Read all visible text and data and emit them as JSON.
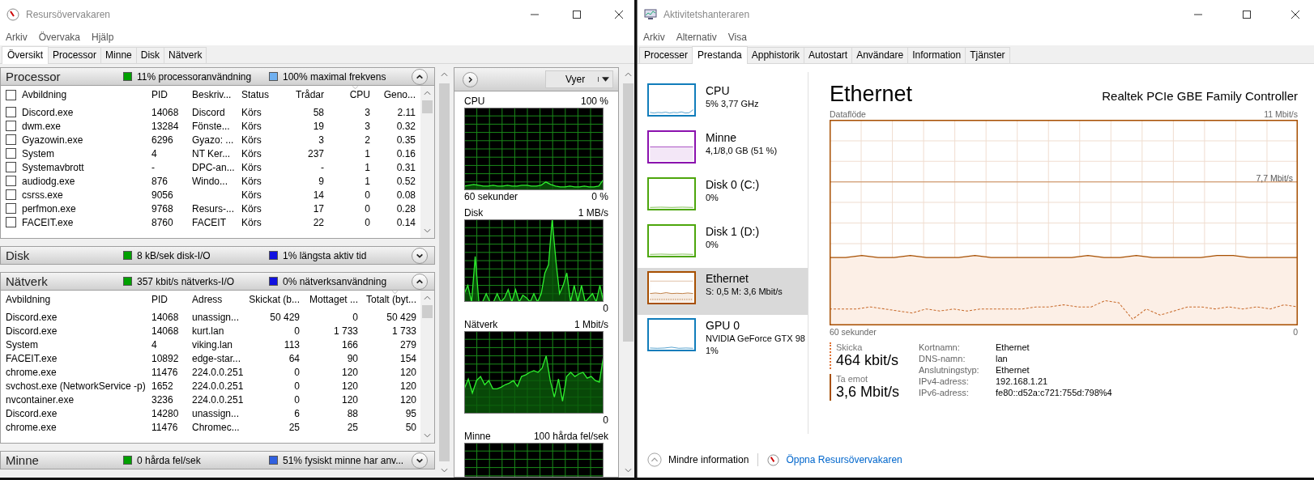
{
  "resource_monitor": {
    "title": "Resursövervakaren",
    "menu": [
      "Arkiv",
      "Övervaka",
      "Hjälp"
    ],
    "tabs": [
      {
        "label": "Översikt",
        "selected": true
      },
      {
        "label": "Processor",
        "selected": false
      },
      {
        "label": "Minne",
        "selected": false
      },
      {
        "label": "Disk",
        "selected": false
      },
      {
        "label": "Nätverk",
        "selected": false
      }
    ],
    "sections": [
      {
        "title": "Processor",
        "expanded": true,
        "indicators": [
          {
            "text": "11% processoranvändning",
            "color": "#00a000"
          },
          {
            "text": "100% maximal frekvens",
            "color": "#70b0f0"
          }
        ],
        "table": {
          "all_checked": false,
          "columns": [
            {
              "label": "Avbildning",
              "kind": "text",
              "sorted": false
            },
            {
              "label": "PID",
              "kind": "text",
              "sorted": false
            },
            {
              "label": "Beskriv...",
              "kind": "text",
              "sorted": false
            },
            {
              "label": "Status",
              "kind": "text",
              "sorted": false
            },
            {
              "label": "Trådar",
              "kind": "number",
              "sorted": false
            },
            {
              "label": "CPU",
              "kind": "number",
              "sorted": true
            },
            {
              "label": "Geno...",
              "kind": "number",
              "sorted": false
            }
          ],
          "rows": [
            {
              "checked": false,
              "cells": [
                "Discord.exe",
                "14068",
                "Discord",
                "Körs",
                "58",
                "3",
                "2.11"
              ]
            },
            {
              "checked": false,
              "cells": [
                "dwm.exe",
                "13284",
                "Fönste...",
                "Körs",
                "19",
                "3",
                "0.32"
              ]
            },
            {
              "checked": false,
              "cells": [
                "Gyazowin.exe",
                "6296",
                "Gyazo: ...",
                "Körs",
                "3",
                "2",
                "0.35"
              ]
            },
            {
              "checked": false,
              "cells": [
                "System",
                "4",
                "NT Ker...",
                "Körs",
                "237",
                "1",
                "0.16"
              ]
            },
            {
              "checked": false,
              "cells": [
                "Systemavbrott",
                "-",
                "DPC-an...",
                "Körs",
                "-",
                "1",
                "0.31"
              ]
            },
            {
              "checked": false,
              "cells": [
                "audiodg.exe",
                "876",
                "Windo...",
                "Körs",
                "9",
                "1",
                "0.52"
              ]
            },
            {
              "checked": false,
              "cells": [
                "csrss.exe",
                "9056",
                "",
                "Körs",
                "14",
                "0",
                "0.08"
              ]
            },
            {
              "checked": false,
              "cells": [
                "perfmon.exe",
                "9768",
                "Resurs-...",
                "Körs",
                "17",
                "0",
                "0.28"
              ]
            },
            {
              "checked": false,
              "cells": [
                "FACEIT.exe",
                "8760",
                "FACEIT",
                "Körs",
                "22",
                "0",
                "0.14"
              ]
            }
          ]
        }
      },
      {
        "title": "Disk",
        "expanded": false,
        "indicators": [
          {
            "text": "8 kB/sek disk-I/O",
            "color": "#00a000"
          },
          {
            "text": "1% längsta aktiv tid",
            "color": "#1010e0"
          }
        ]
      },
      {
        "title": "Nätverk",
        "expanded": true,
        "indicators": [
          {
            "text": "357 kbit/s nätverks-I/O",
            "color": "#00a000"
          },
          {
            "text": "0% nätverksanvändning",
            "color": "#1010e0"
          }
        ],
        "table": {
          "columns": [
            {
              "label": "Avbildning",
              "kind": "text",
              "sorted": false
            },
            {
              "label": "PID",
              "kind": "text",
              "sorted": false
            },
            {
              "label": "Adress",
              "kind": "text",
              "sorted": false
            },
            {
              "label": "Skickat (b...",
              "kind": "number",
              "sorted": false
            },
            {
              "label": "Mottaget ...",
              "kind": "number",
              "sorted": false
            },
            {
              "label": "Totalt (byt...",
              "kind": "number",
              "sorted": true
            }
          ],
          "rows": [
            {
              "cells": [
                "Discord.exe",
                "14068",
                "unassign...",
                "50 429",
                "0",
                "50 429"
              ]
            },
            {
              "cells": [
                "Discord.exe",
                "14068",
                "kurt.lan",
                "0",
                "1 733",
                "1 733"
              ]
            },
            {
              "cells": [
                "System",
                "4",
                "viking.lan",
                "113",
                "166",
                "279"
              ]
            },
            {
              "cells": [
                "FACEIT.exe",
                "10892",
                "edge-star...",
                "64",
                "90",
                "154"
              ]
            },
            {
              "cells": [
                "chrome.exe",
                "11476",
                "224.0.0.251",
                "0",
                "120",
                "120"
              ]
            },
            {
              "cells": [
                "svchost.exe (NetworkService -p)",
                "1652",
                "224.0.0.251",
                "0",
                "120",
                "120"
              ]
            },
            {
              "cells": [
                "nvcontainer.exe",
                "3236",
                "224.0.0.251",
                "0",
                "120",
                "120"
              ]
            },
            {
              "cells": [
                "Discord.exe",
                "14280",
                "unassign...",
                "6",
                "88",
                "95"
              ]
            },
            {
              "cells": [
                "chrome.exe",
                "11476",
                "Chromec...",
                "25",
                "25",
                "50"
              ]
            }
          ]
        }
      },
      {
        "title": "Minne",
        "expanded": false,
        "indicators": [
          {
            "text": "0 hårda fel/sek",
            "color": "#00a000"
          },
          {
            "text": "51% fysiskt minne har anv...",
            "color": "#3060e0"
          }
        ]
      }
    ],
    "graph_panel": {
      "views_label": "Vyer",
      "graphs": [
        {
          "kind": "cpu",
          "title": "CPU",
          "max": "100 %",
          "min": "0 %",
          "time": "60 sekunder"
        },
        {
          "kind": "disk",
          "title": "Disk",
          "max": "1 MB/s",
          "min": "0"
        },
        {
          "kind": "network",
          "title": "Nätverk",
          "max": "1 Mbit/s",
          "min": "0"
        },
        {
          "kind": "memory",
          "title": "Minne",
          "max": "100 hårda fel/sek"
        }
      ]
    }
  },
  "task_manager": {
    "title": "Aktivitetshanteraren",
    "menu": [
      "Arkiv",
      "Alternativ",
      "Visa"
    ],
    "tabs": [
      {
        "label": "Processer",
        "selected": false
      },
      {
        "label": "Prestanda",
        "selected": true
      },
      {
        "label": "Apphistorik",
        "selected": false
      },
      {
        "label": "Autostart",
        "selected": false
      },
      {
        "label": "Användare",
        "selected": false
      },
      {
        "label": "Information",
        "selected": false
      },
      {
        "label": "Tjänster",
        "selected": false
      }
    ],
    "sidebar": [
      {
        "kind": "cpu",
        "title": "CPU",
        "lines": [
          "5%  3,77 GHz"
        ],
        "color": "#117dbb",
        "selected": false
      },
      {
        "kind": "memory",
        "title": "Minne",
        "lines": [
          "4,1/8,0 GB (51 %)"
        ],
        "color": "#8b12ae",
        "selected": false
      },
      {
        "kind": "disk",
        "title": "Disk 0 (C:)",
        "lines": [
          "0%"
        ],
        "color": "#4da60c",
        "selected": false
      },
      {
        "kind": "disk",
        "title": "Disk 1 (D:)",
        "lines": [
          "0%"
        ],
        "color": "#4da60c",
        "selected": false
      },
      {
        "kind": "network",
        "title": "Ethernet",
        "lines": [
          "S: 0,5  M: 3,6 Mbit/s"
        ],
        "color": "#a74f01",
        "selected": true
      },
      {
        "kind": "gpu",
        "title": "GPU 0",
        "lines": [
          "NVIDIA GeForce GTX 98",
          "1%"
        ],
        "color": "#117dbb",
        "selected": false
      }
    ],
    "detail": {
      "title": "Ethernet",
      "device": "Realtek PCIe GBE Family Controller",
      "graph_label": "Dataflöde",
      "graph_max": "11 Mbit/s",
      "graph_mid": "7,7 Mbit/s",
      "time_label": "60 sekunder",
      "graph_min": "0",
      "stats": [
        {
          "kind": "send",
          "label": "Skicka",
          "value": "464 kbit/s"
        },
        {
          "kind": "receive",
          "label": "Ta emot",
          "value": "3,6 Mbit/s"
        }
      ],
      "properties": [
        {
          "label": "Kortnamn:",
          "value": "Ethernet"
        },
        {
          "label": "DNS-namn:",
          "value": "lan"
        },
        {
          "label": "Anslutningstyp:",
          "value": "Ethernet"
        },
        {
          "label": "IPv4-adress:",
          "value": "192.168.1.21"
        },
        {
          "label": "IPv6-adress:",
          "value": "fe80::d52a:c721:755d:798%4"
        }
      ]
    },
    "footer": {
      "less_label": "Mindre information",
      "link": "Öppna Resursövervakaren"
    }
  }
}
